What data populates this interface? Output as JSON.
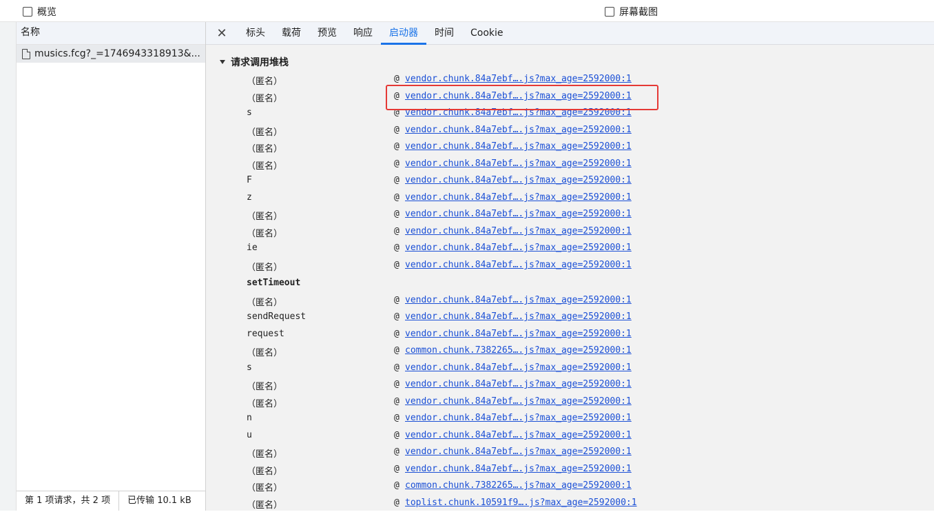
{
  "toolbar": {
    "overview_label": "概览",
    "screenshot_label": "屏幕截图"
  },
  "requests": {
    "column_header": "名称",
    "selected_request": "musics.fcg?_=1746943318913&...",
    "status_count": "第 1 项请求，共 2 项",
    "status_transfer": "已传输 10.1 kB"
  },
  "tabs": {
    "close_icon": "close-icon",
    "items": [
      "标头",
      "载荷",
      "预览",
      "响应",
      "启动器",
      "时间",
      "Cookie"
    ],
    "active": "启动器"
  },
  "initiator": {
    "section_title": "请求调用堆栈",
    "at": "@",
    "frames_group1": [
      {
        "fn": "（匿名）",
        "src": "vendor.chunk.84a7ebf….js?max_age=2592000:1"
      },
      {
        "fn": "（匿名）",
        "src": "vendor.chunk.84a7ebf….js?max_age=2592000:1",
        "highlighted": true
      },
      {
        "fn": "s",
        "src": "vendor.chunk.84a7ebf….js?max_age=2592000:1"
      },
      {
        "fn": "（匿名）",
        "src": "vendor.chunk.84a7ebf….js?max_age=2592000:1"
      },
      {
        "fn": "（匿名）",
        "src": "vendor.chunk.84a7ebf….js?max_age=2592000:1"
      },
      {
        "fn": "（匿名）",
        "src": "vendor.chunk.84a7ebf….js?max_age=2592000:1"
      },
      {
        "fn": "F",
        "src": "vendor.chunk.84a7ebf….js?max_age=2592000:1"
      },
      {
        "fn": "z",
        "src": "vendor.chunk.84a7ebf….js?max_age=2592000:1"
      },
      {
        "fn": "（匿名）",
        "src": "vendor.chunk.84a7ebf….js?max_age=2592000:1"
      },
      {
        "fn": "（匿名）",
        "src": "vendor.chunk.84a7ebf….js?max_age=2592000:1"
      },
      {
        "fn": "ie",
        "src": "vendor.chunk.84a7ebf….js?max_age=2592000:1"
      },
      {
        "fn": "（匿名）",
        "src": "vendor.chunk.84a7ebf….js?max_age=2592000:1"
      }
    ],
    "async_label": "setTimeout",
    "frames_group2": [
      {
        "fn": "（匿名）",
        "src": "vendor.chunk.84a7ebf….js?max_age=2592000:1"
      },
      {
        "fn": "sendRequest",
        "src": "vendor.chunk.84a7ebf….js?max_age=2592000:1"
      },
      {
        "fn": "request",
        "src": "vendor.chunk.84a7ebf….js?max_age=2592000:1"
      },
      {
        "fn": "（匿名）",
        "src": "common.chunk.7382265….js?max_age=2592000:1"
      },
      {
        "fn": "s",
        "src": "vendor.chunk.84a7ebf….js?max_age=2592000:1"
      },
      {
        "fn": "（匿名）",
        "src": "vendor.chunk.84a7ebf….js?max_age=2592000:1"
      },
      {
        "fn": "（匿名）",
        "src": "vendor.chunk.84a7ebf….js?max_age=2592000:1"
      },
      {
        "fn": "n",
        "src": "vendor.chunk.84a7ebf….js?max_age=2592000:1"
      },
      {
        "fn": "u",
        "src": "vendor.chunk.84a7ebf….js?max_age=2592000:1"
      },
      {
        "fn": "（匿名）",
        "src": "vendor.chunk.84a7ebf….js?max_age=2592000:1"
      },
      {
        "fn": "（匿名）",
        "src": "vendor.chunk.84a7ebf….js?max_age=2592000:1"
      },
      {
        "fn": "（匿名）",
        "src": "common.chunk.7382265….js?max_age=2592000:1"
      },
      {
        "fn": "（匿名）",
        "src": "toplist.chunk.10591f9….js?max_age=2592000:1"
      }
    ]
  }
}
